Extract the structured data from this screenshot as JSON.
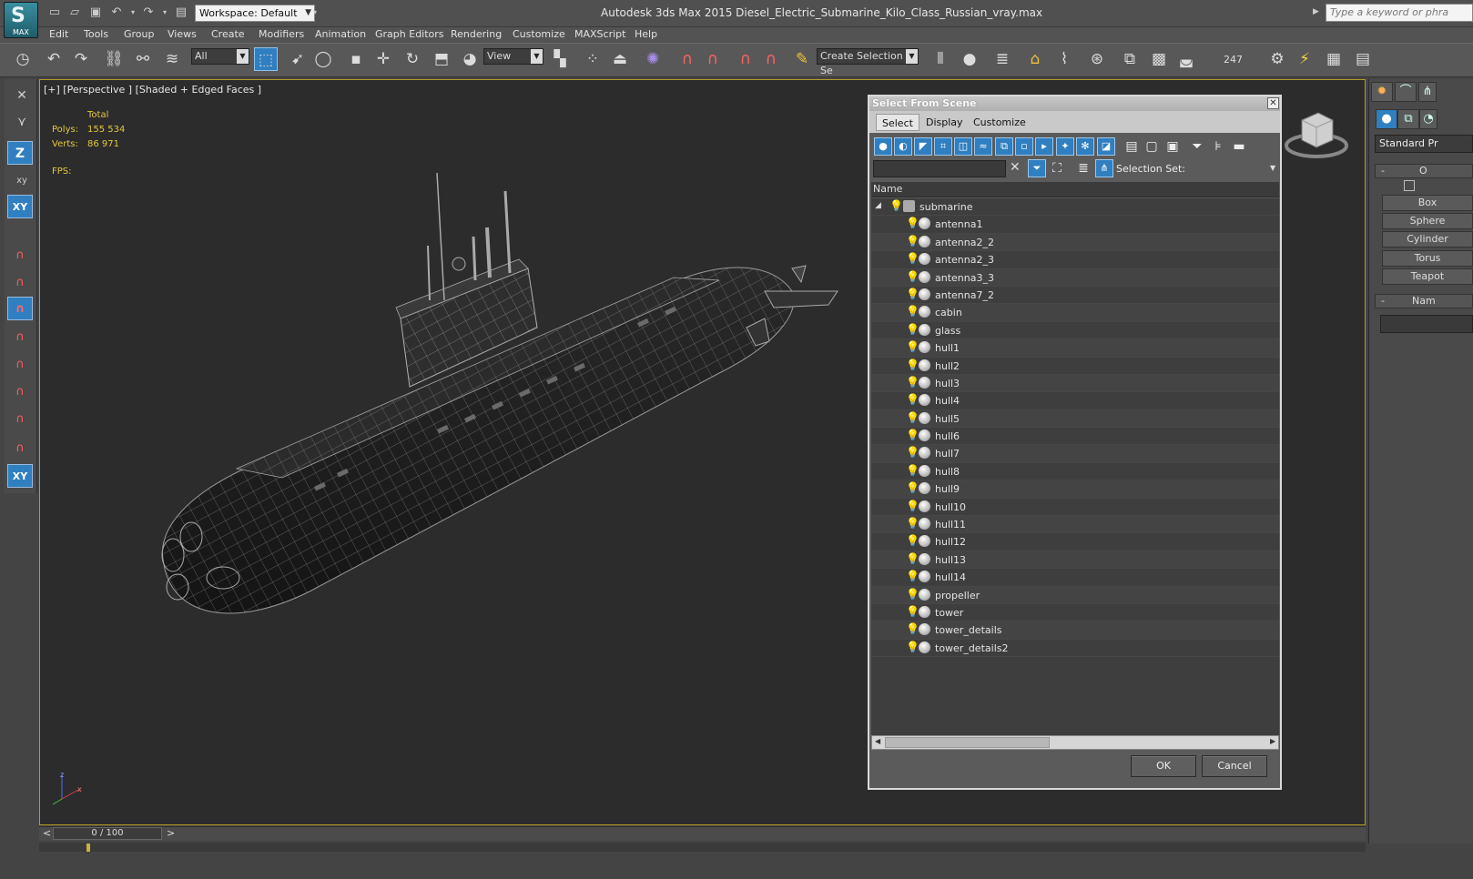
{
  "titlebar": {
    "app_title": "Autodesk 3ds Max  2015    Diesel_Electric_Submarine_Kilo_Class_Russian_vray.max",
    "logo_text": "MAX",
    "workspace": "Workspace: Default",
    "search_placeholder": "Type a keyword or phra"
  },
  "menu": [
    "Edit",
    "Tools",
    "Group",
    "Views",
    "Create",
    "Modifiers",
    "Animation",
    "Graph Editors",
    "Rendering",
    "Customize",
    "MAXScript",
    "Help"
  ],
  "toolbar": {
    "filter_dropdown": "All",
    "ref_coord_dropdown": "View",
    "selection_set": "Create Selection Se",
    "frame_value": "247"
  },
  "leftbar": {
    "z_label": "Z",
    "xy_label": "XY"
  },
  "viewport": {
    "label": "[+] [Perspective ] [Shaded + Edged Faces ]",
    "stats": {
      "total_label": "Total",
      "polys_label": "Polys:",
      "polys_value": "155 534",
      "verts_label": "Verts:",
      "verts_value": "86 971",
      "fps_label": "FPS:"
    }
  },
  "command_panel": {
    "category": "Standard Pr",
    "rollout_object_type": "O",
    "rollout_name": "Nam",
    "buttons": [
      "Box",
      "Sphere",
      "Cylinder",
      "Torus",
      "Teapot"
    ]
  },
  "dialog": {
    "title": "Select From Scene",
    "tabs": [
      "Select",
      "Display",
      "Customize"
    ],
    "selection_set_label": "Selection Set:",
    "column_name": "Name",
    "root": "submarine",
    "items": [
      "antenna1",
      "antenna2_2",
      "antenna2_3",
      "antenna3_3",
      "antenna7_2",
      "cabin",
      "glass",
      "hull1",
      "hull2",
      "hull3",
      "hull4",
      "hull5",
      "hull6",
      "hull7",
      "hull8",
      "hull9",
      "hull10",
      "hull11",
      "hull12",
      "hull13",
      "hull14",
      "propeller",
      "tower",
      "tower_details",
      "tower_details2"
    ],
    "ok_label": "OK",
    "cancel_label": "Cancel"
  },
  "timeline": {
    "slider": "0 / 100",
    "prev": "<",
    "next": ">"
  }
}
